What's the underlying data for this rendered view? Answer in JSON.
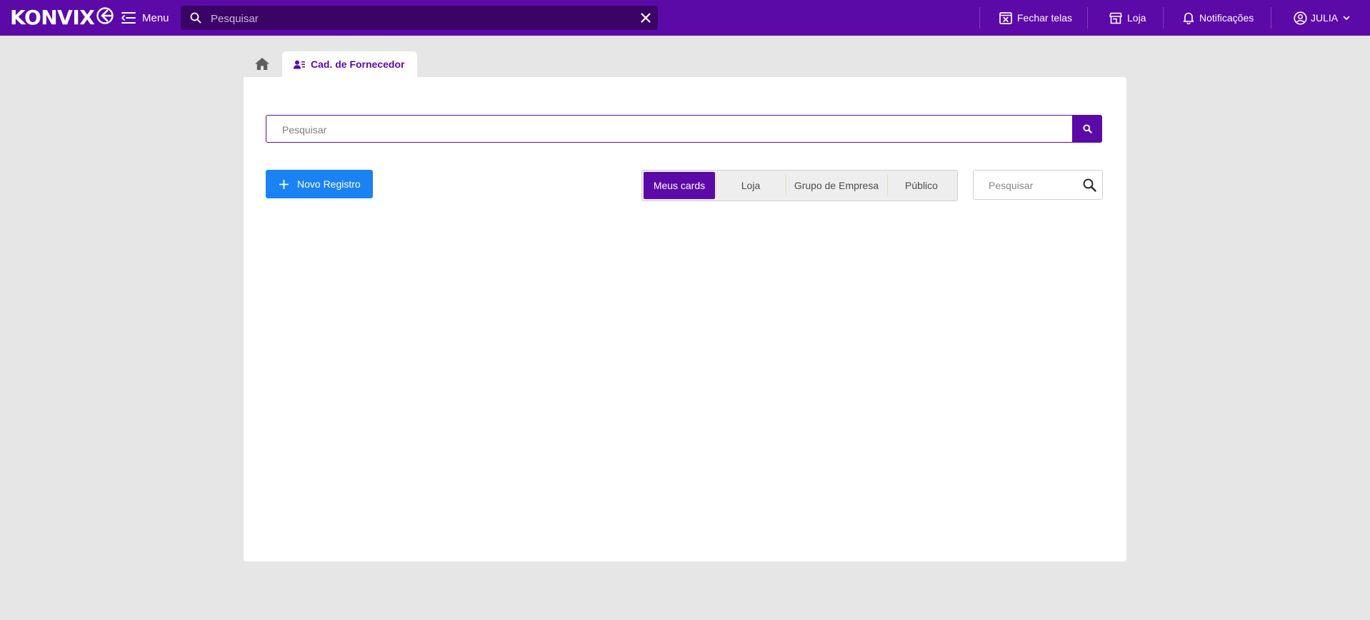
{
  "app": {
    "logo_text": "KONVIX"
  },
  "topbar": {
    "menu_label": "Menu",
    "search_placeholder": "Pesquisar",
    "actions": {
      "close_screens": "Fechar telas",
      "store": "Loja",
      "notifications": "Notificações",
      "user": "JULIA"
    }
  },
  "tabs": {
    "active_label": "Cad. de Fornecedor"
  },
  "main": {
    "search_placeholder": "Pesquisar",
    "new_record_label": "Novo Registro",
    "filters": [
      "Meus cards",
      "Loja",
      "Grupo de Empresa",
      "Público"
    ],
    "active_filter": "Meus cards",
    "card_search_placeholder": "Pesquisar"
  },
  "colors": {
    "brand": "#5b0aa8",
    "brand_dark": "#3b0366",
    "primary_button": "#1a82f2",
    "background": "#e6e6e6"
  },
  "icons": {
    "menu": "menu-icon",
    "search": "search-icon",
    "clear": "close-icon",
    "close_screens": "close-window-icon",
    "store": "store-icon",
    "notifications": "bell-icon",
    "user": "user-circle-icon",
    "home": "home-icon",
    "supplier": "user-list-icon",
    "add": "plus-icon"
  }
}
